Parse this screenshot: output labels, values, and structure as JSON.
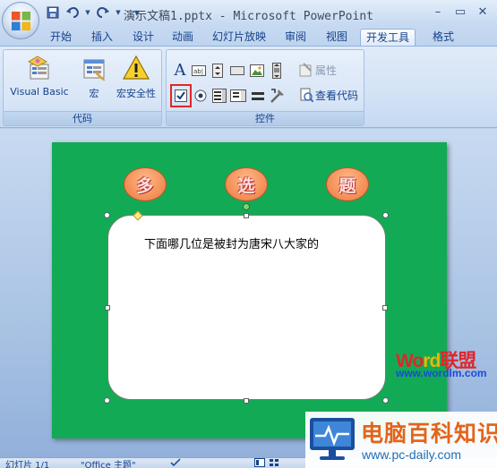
{
  "window": {
    "title": "演示文稿1.pptx - Microsoft PowerPoint",
    "minimize": "–",
    "restore": "▭",
    "close": "✕"
  },
  "qat": {
    "save_icon": "save-icon",
    "undo_icon": "undo-icon",
    "redo_icon": "redo-icon",
    "customize": "▼"
  },
  "tabs": [
    {
      "label": "开始"
    },
    {
      "label": "插入"
    },
    {
      "label": "设计"
    },
    {
      "label": "动画"
    },
    {
      "label": "幻灯片放映"
    },
    {
      "label": "审阅"
    },
    {
      "label": "视图"
    },
    {
      "label": "开发工具"
    },
    {
      "label": "格式"
    }
  ],
  "active_tab": "开发工具",
  "ribbon": {
    "code_group": {
      "label": "代码",
      "visual_basic": "Visual Basic",
      "macros": "宏",
      "macro_security": "宏安全性"
    },
    "controls_group": {
      "label": "控件",
      "properties": "属性",
      "view_code": "查看代码"
    }
  },
  "slide": {
    "shapes": [
      "多",
      "选",
      "题"
    ],
    "question": "下面哪几位是被封为唐宋八大家的",
    "background_color": "#13aa55"
  },
  "watermark": {
    "logo_part1": "Wo",
    "logo_part2": "rd",
    "logo_part3": "联盟",
    "url": "www.wordlm.com"
  },
  "status": {
    "slide_info": "幻灯片 1/1",
    "theme": "\"Office 主题\""
  },
  "brand": {
    "name": "电脑百科知识",
    "url": "www.pc-daily.com"
  },
  "colors": {
    "accent_highlight": "#e0262a",
    "brand_orange": "#e4641c"
  }
}
